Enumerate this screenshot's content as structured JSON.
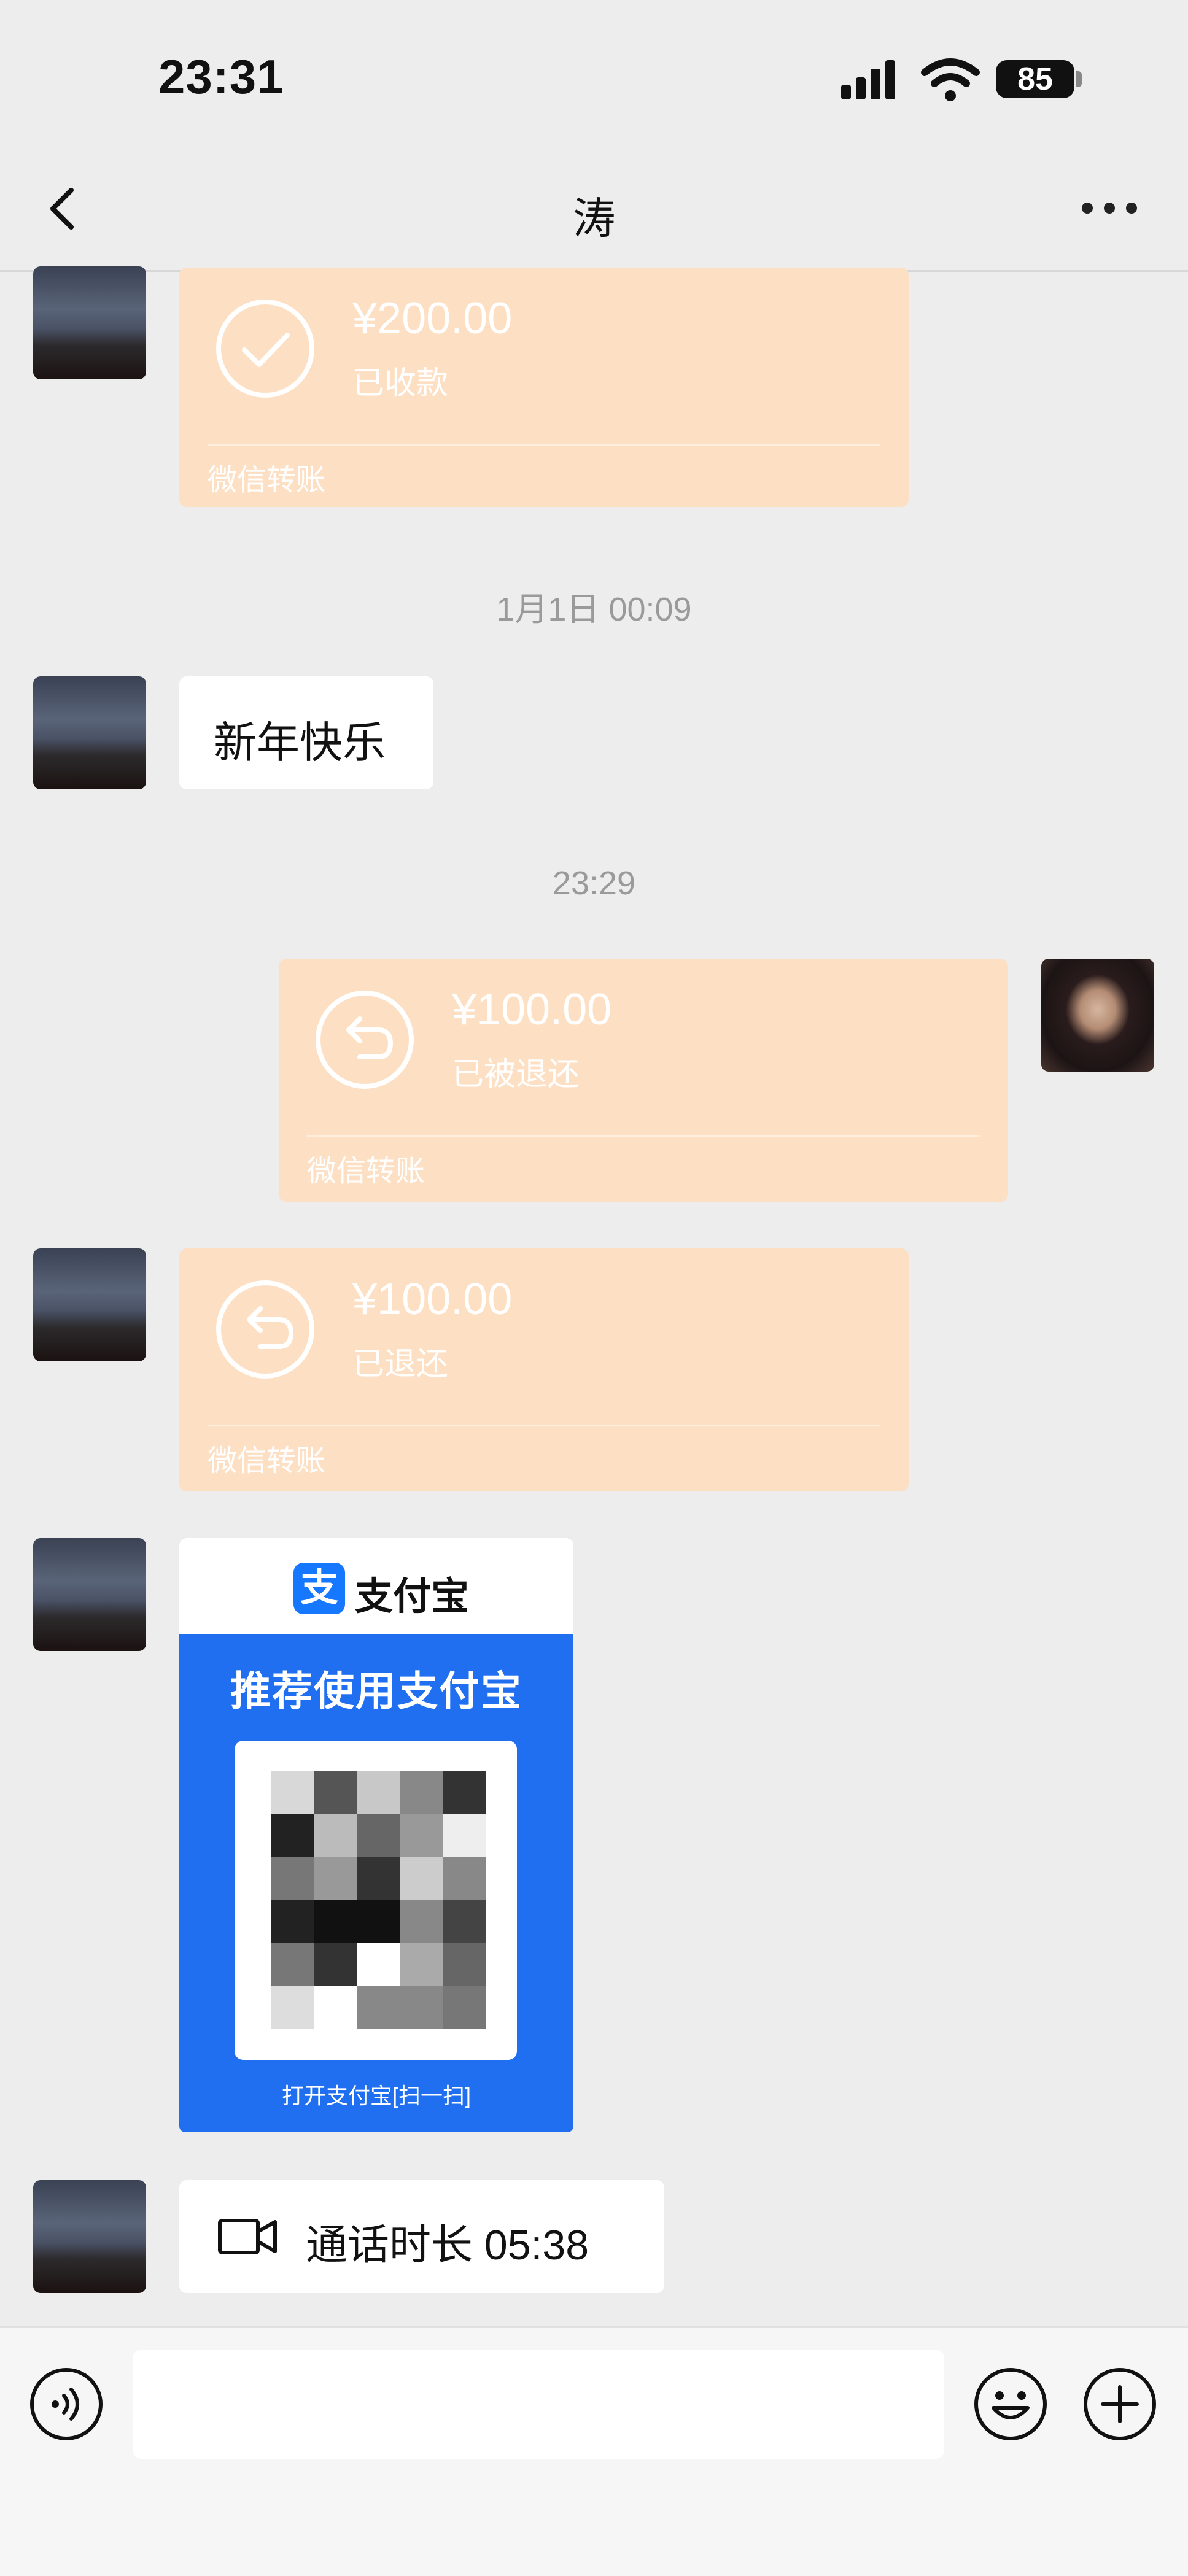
{
  "status_bar": {
    "time": "23:31",
    "battery": "85"
  },
  "nav": {
    "title": "涛"
  },
  "messages": {
    "transfer_1": {
      "amount": "¥200.00",
      "status": "已收款",
      "caption": "微信转账"
    },
    "timestamp_1": "1月1日 00:09",
    "text_1": "新年快乐",
    "timestamp_2": "23:29",
    "transfer_2": {
      "amount": "¥100.00",
      "status": "已被退还",
      "caption": "微信转账"
    },
    "transfer_3": {
      "amount": "¥100.00",
      "status": "已退还",
      "caption": "微信转账"
    },
    "alipay_card": {
      "brand": "支付宝",
      "headline": "推荐使用支付宝",
      "footer": "打开支付宝[扫一扫]"
    },
    "call": {
      "text": "通话时长 05:38"
    }
  },
  "colors": {
    "transfer_bg": "#fde0c4",
    "chat_bg": "#ededed",
    "alipay_blue": "#1f6ff0"
  },
  "icons": [
    "back-icon",
    "more-icon",
    "check-icon",
    "return-icon",
    "video-call-icon",
    "voice-icon",
    "emoji-icon",
    "plus-icon"
  ]
}
